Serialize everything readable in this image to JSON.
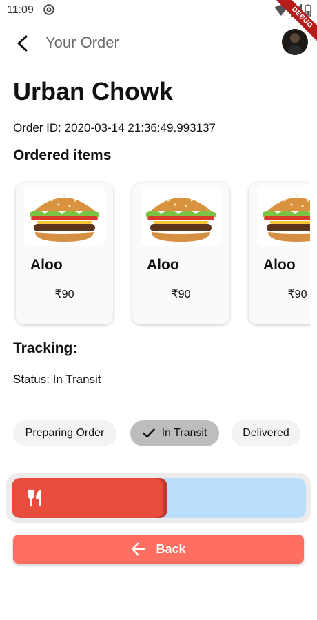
{
  "status_bar": {
    "time": "11:09"
  },
  "debug_banner": "DEBUG",
  "appbar": {
    "title": "Your Order",
    "back_icon": "arrow-back-icon",
    "avatar_icon": "avatar"
  },
  "order": {
    "restaurant": "Urban Chowk",
    "order_id": "Order ID: 2020-03-14 21:36:49.993137"
  },
  "ordered_items": {
    "heading": "Ordered items",
    "items": [
      {
        "name": "Aloo",
        "price": "₹90",
        "image_icon": "burger-icon"
      },
      {
        "name": "Aloo",
        "price": "₹90",
        "image_icon": "burger-icon"
      },
      {
        "name": "Aloo",
        "price": "₹90",
        "image_icon": "burger-icon"
      }
    ]
  },
  "tracking": {
    "heading": "Tracking:",
    "status": "Status: In Transit",
    "steps": [
      {
        "label": "Preparing Order",
        "selected": false
      },
      {
        "label": "In Transit",
        "selected": true
      },
      {
        "label": "Delivered",
        "selected": false
      }
    ],
    "progress_fraction": 0.53,
    "progress_icon": "fork-knife-icon"
  },
  "back_button": {
    "label": "Back",
    "icon": "arrow-back-icon"
  },
  "colors": {
    "accent": "#ff6f61",
    "progress_fill": "#e74c3c",
    "progress_track": "#bbdefb",
    "chip_selected": "#bdbdbd",
    "chip_default": "#f3f3f3"
  }
}
